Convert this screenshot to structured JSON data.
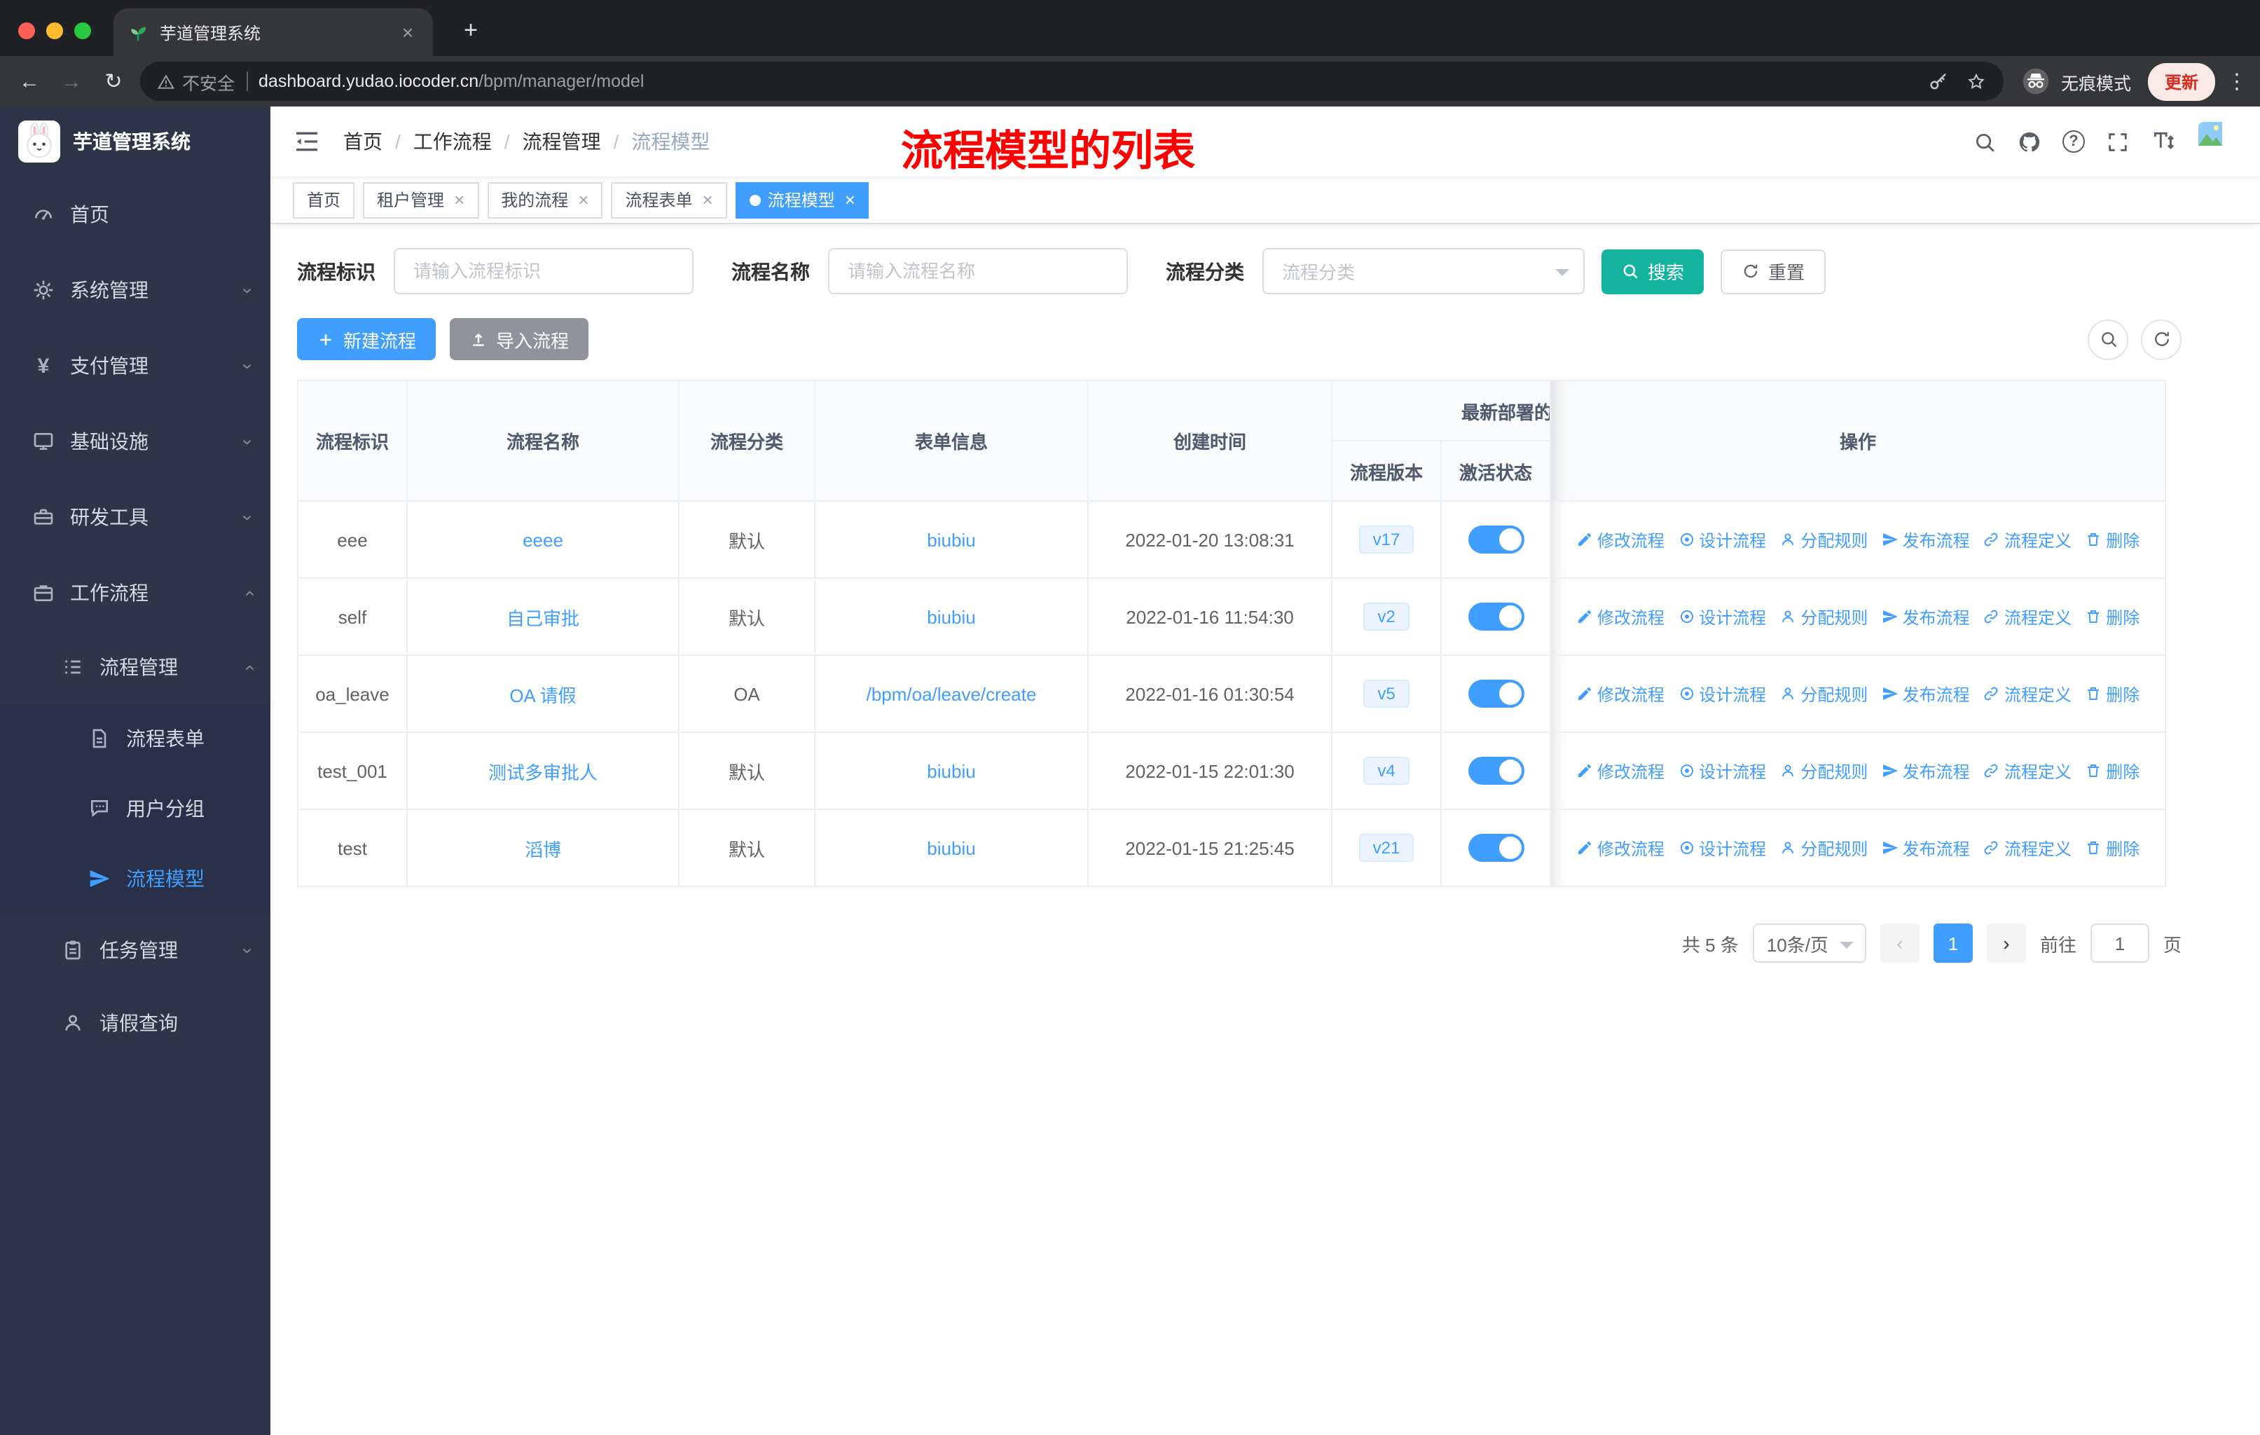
{
  "browser": {
    "tab_title": "芋道管理系统",
    "security_label": "不安全",
    "url_domain": "dashboard.yudao.iocoder.cn",
    "url_path": "/bpm/manager/model",
    "incognito_label": "无痕模式",
    "update_label": "更新"
  },
  "sidebar": {
    "logo_title": "芋道管理系统",
    "items": [
      {
        "label": "首页"
      },
      {
        "label": "系统管理"
      },
      {
        "label": "支付管理"
      },
      {
        "label": "基础设施"
      },
      {
        "label": "研发工具"
      },
      {
        "label": "工作流程"
      }
    ],
    "process_mgmt": "流程管理",
    "children": [
      {
        "label": "流程表单"
      },
      {
        "label": "用户分组"
      },
      {
        "label": "流程模型"
      }
    ],
    "task_mgmt": "任务管理",
    "leave_query": "请假查询"
  },
  "navbar": {
    "breadcrumb": [
      {
        "label": "首页"
      },
      {
        "label": "工作流程"
      },
      {
        "label": "流程管理"
      },
      {
        "label": "流程模型"
      }
    ],
    "separator": "/",
    "annotation": "流程模型的列表"
  },
  "tags": [
    {
      "label": "首页"
    },
    {
      "label": "租户管理"
    },
    {
      "label": "我的流程"
    },
    {
      "label": "流程表单"
    },
    {
      "label": "流程模型"
    }
  ],
  "filters": {
    "key_label": "流程标识",
    "key_placeholder": "请输入流程标识",
    "name_label": "流程名称",
    "name_placeholder": "请输入流程名称",
    "category_label": "流程分类",
    "category_placeholder": "流程分类",
    "search_label": "搜索",
    "reset_label": "重置"
  },
  "toolbar": {
    "create_label": "新建流程",
    "import_label": "导入流程"
  },
  "table": {
    "headers": {
      "key": "流程标识",
      "name": "流程名称",
      "category": "流程分类",
      "form": "表单信息",
      "created": "创建时间",
      "deploy_group": "最新部署的",
      "version": "流程版本",
      "status": "激活状态",
      "actions": "操作"
    },
    "action_labels": [
      "修改流程",
      "设计流程",
      "分配规则",
      "发布流程",
      "流程定义",
      "删除"
    ],
    "rows": [
      {
        "key": "eee",
        "name": "eeee",
        "category": "默认",
        "form": "biubiu",
        "created": "2022-01-20 13:08:31",
        "version": "v17",
        "active": true
      },
      {
        "key": "self",
        "name": "自己审批",
        "category": "默认",
        "form": "biubiu",
        "created": "2022-01-16 11:54:30",
        "version": "v2",
        "active": true
      },
      {
        "key": "oa_leave",
        "name": "OA 请假",
        "category": "OA",
        "form": "/bpm/oa/leave/create",
        "created": "2022-01-16 01:30:54",
        "version": "v5",
        "active": true
      },
      {
        "key": "test_001",
        "name": "测试多审批人",
        "category": "默认",
        "form": "biubiu",
        "created": "2022-01-15 22:01:30",
        "version": "v4",
        "active": true
      },
      {
        "key": "test",
        "name": "滔博",
        "category": "默认",
        "form": "biubiu",
        "created": "2022-01-15 21:25:45",
        "version": "v21",
        "active": true
      }
    ]
  },
  "pagination": {
    "total": "共 5 条",
    "page_size": "10条/页",
    "page": "1",
    "goto_label": "前往",
    "goto_value": "1",
    "unit": "页"
  },
  "colors": {
    "primary": "#409eff",
    "search_button": "#14b3a0",
    "import_button": "#909399",
    "annotation": "#ff0000",
    "sidebar_bg": "#2f3548",
    "active_tag": "#409eff"
  }
}
